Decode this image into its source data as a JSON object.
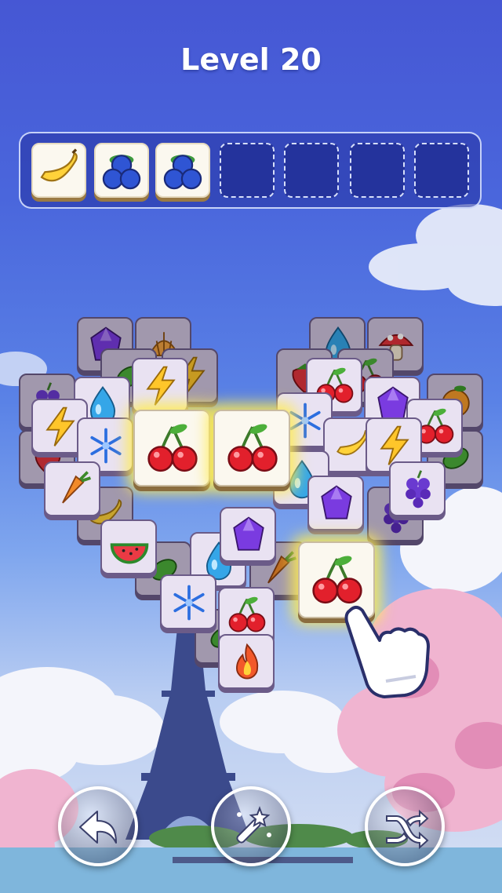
{
  "level": {
    "title": "Level 20"
  },
  "tray": {
    "slots": [
      {
        "state": "filled",
        "icon": "banana-icon"
      },
      {
        "state": "filled",
        "icon": "blueberry-icon"
      },
      {
        "state": "filled",
        "icon": "blueberry-icon"
      },
      {
        "state": "empty"
      },
      {
        "state": "empty"
      },
      {
        "state": "empty"
      },
      {
        "state": "empty"
      }
    ]
  },
  "board": {
    "highlighted_tiles": [
      "cherry-icon",
      "cherry-icon",
      "cherry-icon"
    ]
  },
  "controls": {
    "undo": "undo-icon",
    "magic": "magic-wand-icon",
    "shuffle": "shuffle-icon"
  },
  "colors": {
    "sky_top": "#4657d4",
    "tray_bg": "#24339c",
    "tile_face": "#e9e2f2",
    "highlight_glow": "#ffec50"
  }
}
